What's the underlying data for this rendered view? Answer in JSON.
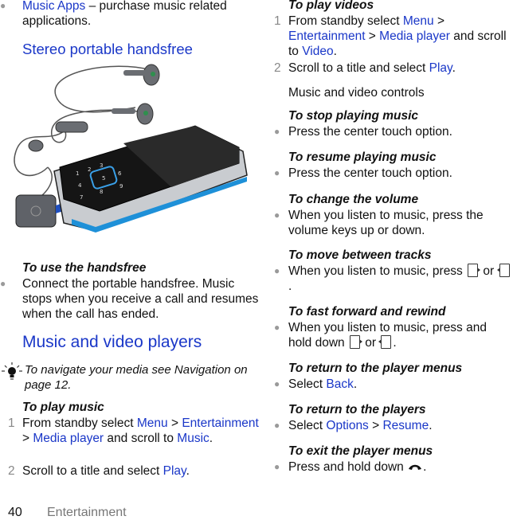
{
  "left": {
    "intro_item": {
      "link": "Music Apps",
      "text": " – purchase music related applications."
    },
    "section1_title": "Stereo portable handsfree",
    "illustration_alt": "Phone with stereo portable handsfree being connected",
    "task1": {
      "title": "To use the handsfree",
      "bullet": "Connect the portable handsfree. Music stops when you receive a call and resumes when the call has ended."
    },
    "section2_title": "Music and video players",
    "tip": "To navigate your media see Navigation on page 12.",
    "task2": {
      "title": "To play music",
      "step1": {
        "n": "1",
        "a": "From standby select ",
        "l1": "Menu",
        "sep1": " > ",
        "l2": "Entertainment",
        "sep2": " > ",
        "l3": "Media player",
        "b": " and scroll to ",
        "l4": "Music",
        "end": "."
      },
      "step2": {
        "n": "2",
        "a": "Scroll to a title and select ",
        "l1": "Play",
        "end": "."
      }
    }
  },
  "right": {
    "task3": {
      "title": "To play videos",
      "step1": {
        "n": "1",
        "a": "From standby select ",
        "l1": "Menu",
        "sep1": " > ",
        "l2": "Entertainment",
        "sep2": " > ",
        "l3": "Media player",
        "b": " and scroll to ",
        "l4": "Video",
        "end": "."
      },
      "step2": {
        "n": "2",
        "a": "Scroll to a title and select ",
        "l1": "Play",
        "end": "."
      }
    },
    "subheading": "Music and video controls",
    "stop": {
      "title": "To stop playing music",
      "bullet": "Press the center touch option."
    },
    "resume": {
      "title": "To resume playing music",
      "bullet": "Press the center touch option."
    },
    "volume": {
      "title": "To change the volume",
      "bullet": "When you listen to music, press the volume keys up or down."
    },
    "tracks": {
      "title": "To move between tracks",
      "a": "When you listen to music, press ",
      "or": " or ",
      "end": "."
    },
    "ffwd": {
      "title": "To fast forward and rewind",
      "a": "When you listen to music, press and hold down ",
      "or": " or ",
      "end": "."
    },
    "return_menus": {
      "title": "To return to the player menus",
      "a": "Select ",
      "l1": "Back",
      "end": "."
    },
    "return_players": {
      "title": "To return to the players",
      "a": "Select ",
      "l1": "Options",
      "sep": " > ",
      "l2": "Resume",
      "end": "."
    },
    "exit": {
      "title": "To exit the player menus",
      "a": "Press and hold down ",
      "end": "."
    }
  },
  "footer": {
    "page_number": "40",
    "section": "Entertainment"
  }
}
